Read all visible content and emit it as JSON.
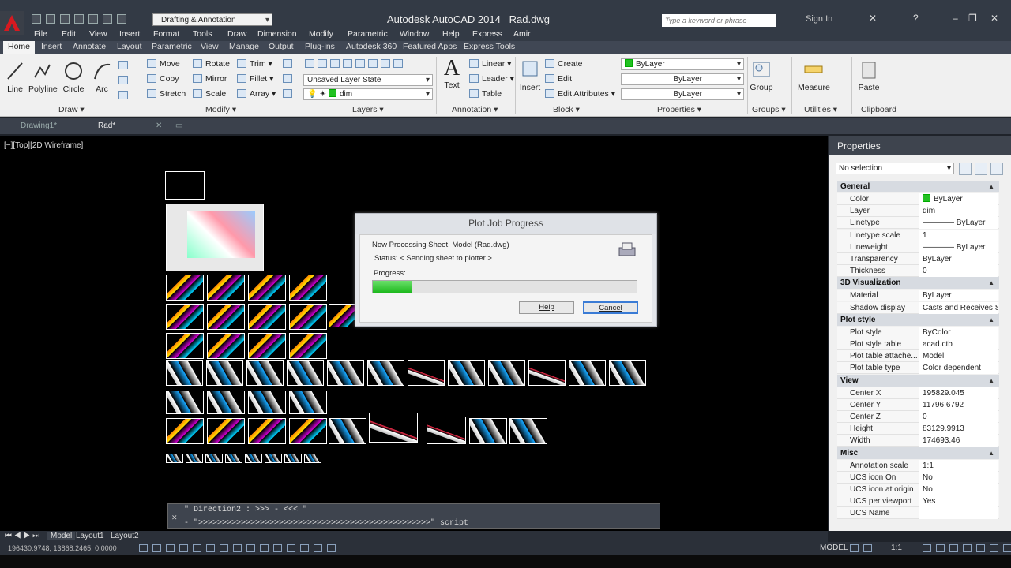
{
  "app": {
    "title": "Autodesk AutoCAD 2014",
    "file": "Rad.dwg",
    "workspace": "Drafting & Annotation",
    "search_placeholder": "Type a keyword or phrase",
    "sign_in": "Sign In"
  },
  "menu": [
    "File",
    "Edit",
    "View",
    "Insert",
    "Format",
    "Tools",
    "Draw",
    "Dimension",
    "Modify",
    "Parametric",
    "Window",
    "Help",
    "Express",
    "Amir"
  ],
  "ribbon_tabs": [
    "Home",
    "Insert",
    "Annotate",
    "Layout",
    "Parametric",
    "View",
    "Manage",
    "Output",
    "Plug-ins",
    "Autodesk 360",
    "Featured Apps",
    "Express Tools"
  ],
  "ribbon": {
    "draw": {
      "line": "Line",
      "polyline": "Polyline",
      "circle": "Circle",
      "arc": "Arc",
      "footer": "Draw ▾"
    },
    "modify": {
      "move": "Move",
      "rotate": "Rotate",
      "trim": "Trim ▾",
      "copy": "Copy",
      "mirror": "Mirror",
      "fillet": "Fillet ▾",
      "stretch": "Stretch",
      "scale": "Scale",
      "array": "Array ▾",
      "footer": "Modify ▾"
    },
    "layers": {
      "state": "Unsaved Layer State",
      "layer": "dim",
      "footer": "Layers ▾"
    },
    "annotation": {
      "text": "Text",
      "linear": "Linear ▾",
      "leader": "Leader ▾",
      "table": "Table",
      "footer": "Annotation ▾"
    },
    "block": {
      "insert": "Insert",
      "create": "Create",
      "edit": "Edit",
      "edit_attributes": "Edit Attributes ▾",
      "footer": "Block ▾"
    },
    "properties": {
      "color": "ByLayer",
      "linetype": "ByLayer",
      "lineweight": "ByLayer",
      "footer": "Properties ▾"
    },
    "groups": {
      "group": "Group",
      "footer": "Groups ▾"
    },
    "utilities": {
      "measure": "Measure",
      "footer": "Utilities ▾"
    },
    "clipboard": {
      "paste": "Paste",
      "footer": "Clipboard"
    }
  },
  "doc_tabs": [
    "Drawing1*",
    "Rad*"
  ],
  "viewport_label": "[−][Top][2D Wireframe]",
  "dialog": {
    "title": "Plot Job Progress",
    "processing": "Now Processing Sheet: Model (Rad.dwg)",
    "status": "Status:  < Sending sheet to plotter >",
    "progress_label": "Progress:",
    "progress": 0.15,
    "help": "Help",
    "cancel": "Cancel"
  },
  "command": {
    "history": "\" Direction2 : >>> - <<< \"",
    "input": "- \">>>>>>>>>>>>>>>>>>>>>>>>>>>>>>>>>>>>>>>>>>>>>>>>>\" script"
  },
  "layout_tabs": [
    "Model",
    "Layout1",
    "Layout2"
  ],
  "status": {
    "coords": "196430.9748, 13868.2465, 0.0000",
    "model": "MODEL",
    "scale": "1:1"
  },
  "properties": {
    "title": "Properties",
    "selection": "No selection",
    "sections": [
      {
        "name": "General",
        "rows": [
          [
            "Color",
            "ByLayer"
          ],
          [
            "Layer",
            "dim"
          ],
          [
            "Linetype",
            "———— ByLayer"
          ],
          [
            "Linetype scale",
            "1"
          ],
          [
            "Lineweight",
            "———— ByLayer"
          ],
          [
            "Transparency",
            "ByLayer"
          ],
          [
            "Thickness",
            "0"
          ]
        ]
      },
      {
        "name": "3D Visualization",
        "rows": [
          [
            "Material",
            "ByLayer"
          ],
          [
            "Shadow display",
            "Casts and Receives Sh..."
          ]
        ]
      },
      {
        "name": "Plot style",
        "rows": [
          [
            "Plot style",
            "ByColor"
          ],
          [
            "Plot style table",
            "acad.ctb"
          ],
          [
            "Plot table attache...",
            "Model"
          ],
          [
            "Plot table type",
            "Color dependent"
          ]
        ]
      },
      {
        "name": "View",
        "rows": [
          [
            "Center X",
            "195829.045"
          ],
          [
            "Center Y",
            "11796.6792"
          ],
          [
            "Center Z",
            "0"
          ],
          [
            "Height",
            "83129.9913"
          ],
          [
            "Width",
            "174693.46"
          ]
        ]
      },
      {
        "name": "Misc",
        "rows": [
          [
            "Annotation scale",
            "1:1"
          ],
          [
            "UCS icon On",
            "No"
          ],
          [
            "UCS icon at origin",
            "No"
          ],
          [
            "UCS per viewport",
            "Yes"
          ],
          [
            "UCS Name",
            ""
          ]
        ]
      }
    ]
  },
  "colors": {
    "accent": "#3a7bd5",
    "progress": "#1db81d",
    "layer_swatch": "#22c122"
  }
}
